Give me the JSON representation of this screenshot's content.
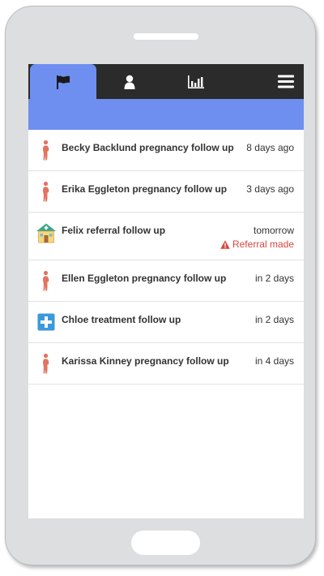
{
  "tabs": [
    {
      "id": "tasks",
      "icon": "flag-icon",
      "active": true
    },
    {
      "id": "people",
      "icon": "person-icon",
      "active": false
    },
    {
      "id": "analytics",
      "icon": "bar-chart-icon",
      "active": false
    },
    {
      "id": "menu",
      "icon": "hamburger-menu-icon",
      "active": false
    }
  ],
  "colors": {
    "accent": "#6e8ff0",
    "tabbar": "#2b2b2b",
    "warning": "#d9473f",
    "pregnancy_icon": "#e3735e",
    "treatment_icon": "#3a9ad9"
  },
  "tasks": [
    {
      "icon": "pregnancy-icon",
      "title": "Becky Backlund pregnancy follow up",
      "due": "8 days ago"
    },
    {
      "icon": "pregnancy-icon",
      "title": "Erika Eggleton pregnancy follow up",
      "due": "3 days ago"
    },
    {
      "icon": "house-referral-icon",
      "title": "Felix referral follow up",
      "due": "tomorrow",
      "status": "Referral made"
    },
    {
      "icon": "pregnancy-icon",
      "title": "Ellen Eggleton pregnancy follow up",
      "due": "in 2 days"
    },
    {
      "icon": "medical-cross-icon",
      "title": "Chloe treatment follow up",
      "due": "in 2 days"
    },
    {
      "icon": "pregnancy-icon",
      "title": "Karissa Kinney pregnancy follow up",
      "due": "in 4 days"
    }
  ]
}
